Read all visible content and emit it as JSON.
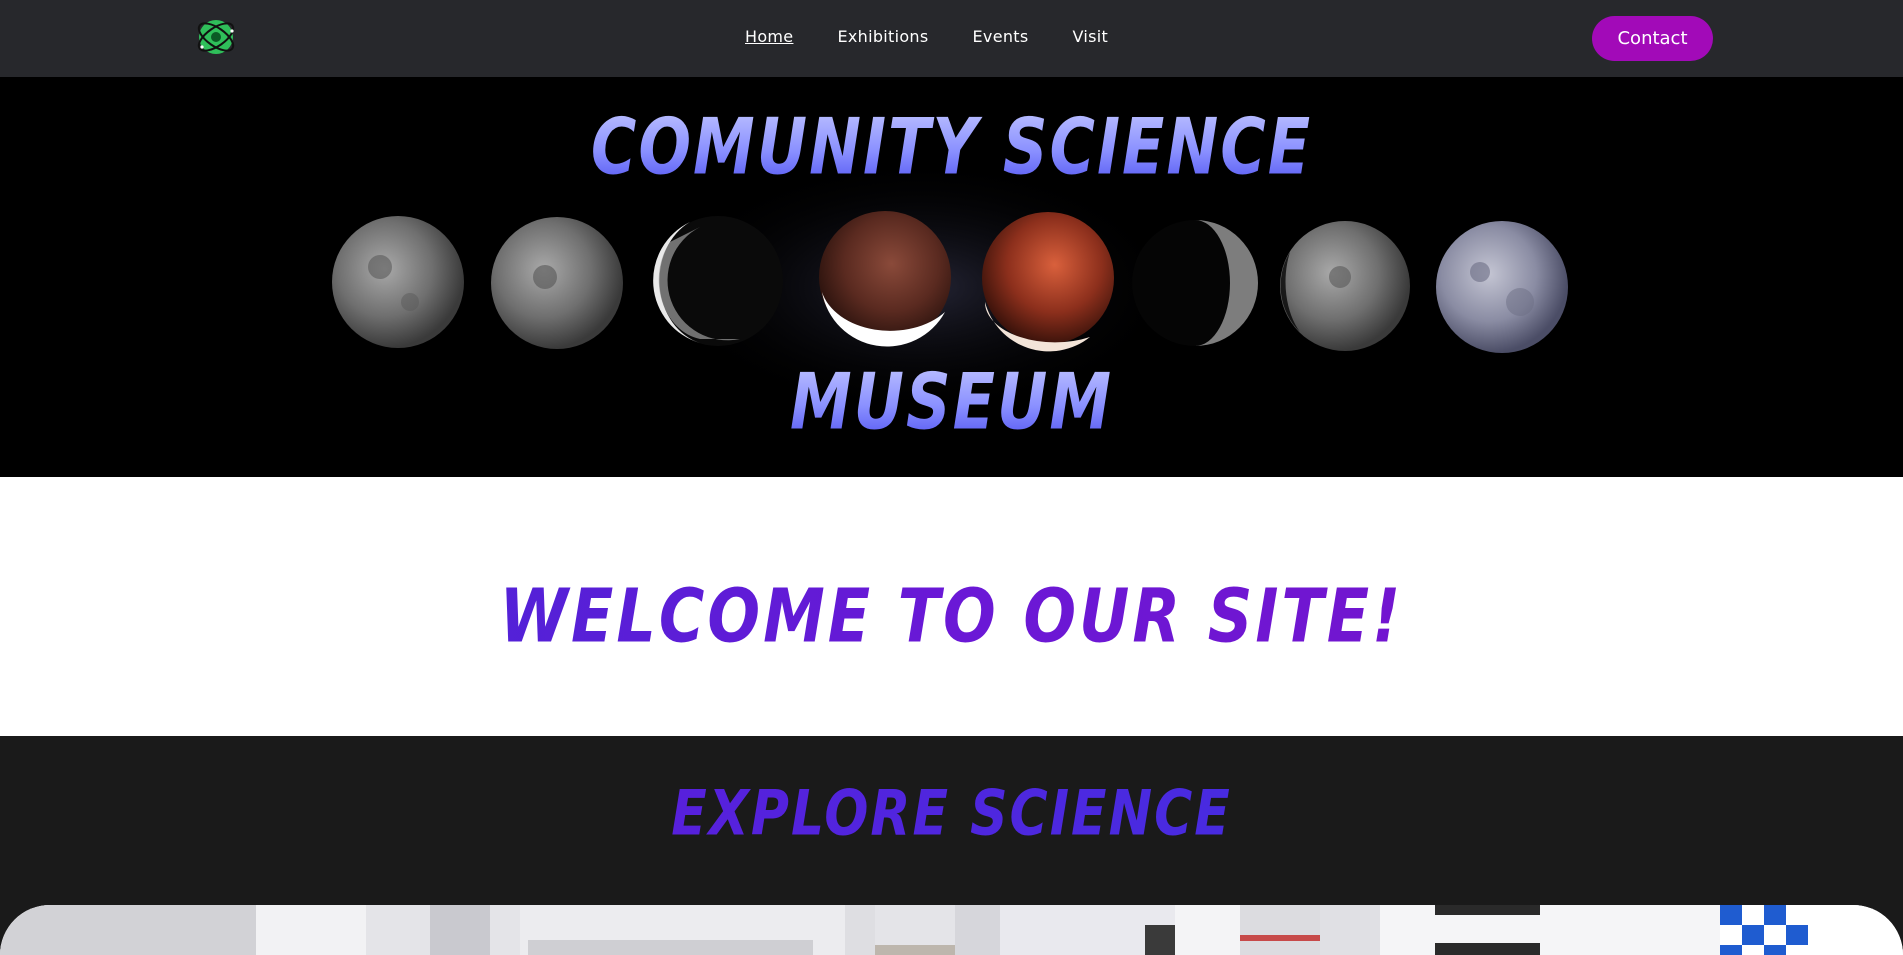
{
  "header": {
    "logo_icon": "atom-logo-icon",
    "nav": [
      {
        "label": "Home",
        "active": true
      },
      {
        "label": "Exhibitions",
        "active": false
      },
      {
        "label": "Events",
        "active": false
      },
      {
        "label": "Visit",
        "active": false
      }
    ],
    "contact_label": "Contact",
    "colors": {
      "background": "#27282c",
      "contact_button": "#a20ab8"
    }
  },
  "hero": {
    "title_line1": "Comunity Science",
    "title_line2": "Museum",
    "image": "lunar-eclipse-phases-image"
  },
  "welcome": {
    "title": "Welcome to our site!"
  },
  "explore": {
    "title": "Explore Science",
    "image": "museum-interior-image"
  }
}
